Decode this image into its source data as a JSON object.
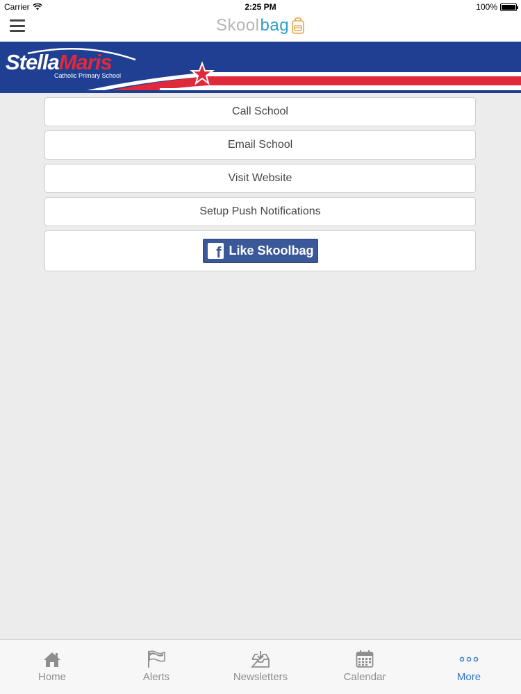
{
  "status_bar": {
    "carrier": "Carrier",
    "time": "2:25 PM",
    "battery": "100%"
  },
  "nav": {
    "logo_part1": "Skool",
    "logo_part2": "bag",
    "menu_icon": "hamburger-icon",
    "colors": {
      "skool": "#b7b7b7",
      "bag": "#2ba0c8"
    }
  },
  "banner": {
    "school_word1": "Stella",
    "school_word2": "Maris",
    "subtitle": "Catholic Primary School",
    "colors": {
      "blue": "#1f3f93",
      "red": "#e0293a",
      "white": "#ffffff"
    }
  },
  "actions": {
    "call": "Call School",
    "email": "Email School",
    "website": "Visit Website",
    "push": "Setup Push Notifications",
    "facebook_like": "Like Skoolbag",
    "facebook_color": "#3b5998"
  },
  "tabs": [
    {
      "label": "Home",
      "icon": "home-icon"
    },
    {
      "label": "Alerts",
      "icon": "flag-icon"
    },
    {
      "label": "Newsletters",
      "icon": "inbox-download-icon"
    },
    {
      "label": "Calendar",
      "icon": "calendar-icon"
    },
    {
      "label": "More",
      "icon": "more-dots-icon",
      "active": true
    }
  ],
  "tab_colors": {
    "inactive": "#8e8e8e",
    "active": "#2d73c7"
  }
}
